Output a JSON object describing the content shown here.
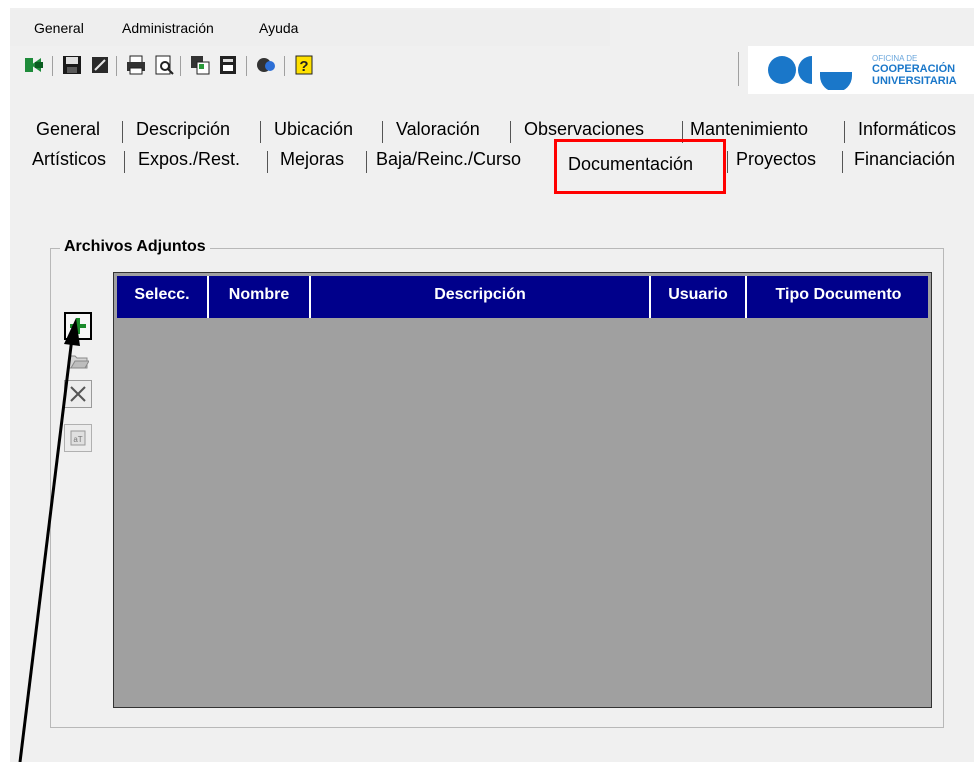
{
  "menubar": {
    "items": [
      "General",
      "Administración",
      "Ayuda"
    ]
  },
  "toolbar": {
    "buttons": [
      "exit-icon",
      "save-icon",
      "edit-icon",
      "print-icon",
      "print-preview-icon",
      "copy-icon",
      "delete-record-icon",
      "refresh-icon",
      "help-icon"
    ]
  },
  "logo": {
    "line1": "OFICINA DE",
    "line2": "COOPERACIÓN",
    "line3": "UNIVERSITARIA",
    "color": "#1a77c9"
  },
  "tabs": {
    "row1": [
      "General",
      "Descripción",
      "Ubicación",
      "Valoración",
      "Observaciones",
      "Mantenimiento",
      "Informáticos"
    ],
    "row2": [
      "Artísticos",
      "Expos./Rest.",
      "Mejoras",
      "Baja/Reinc./Curso",
      "Documentación",
      "Proyectos",
      "Financiación"
    ],
    "active": "Documentación"
  },
  "attachments": {
    "title": "Archivos Adjuntos",
    "columns": [
      "Selecc.",
      "Nombre",
      "Descripción",
      "Usuario",
      "Tipo Documento"
    ],
    "rows": [],
    "side_buttons": [
      "add-icon",
      "open-folder-icon",
      "delete-icon",
      "rename-icon"
    ]
  },
  "colors": {
    "header_bg": "#00008b",
    "grid_bg": "#a0a0a0",
    "highlight": "#ff0000"
  }
}
